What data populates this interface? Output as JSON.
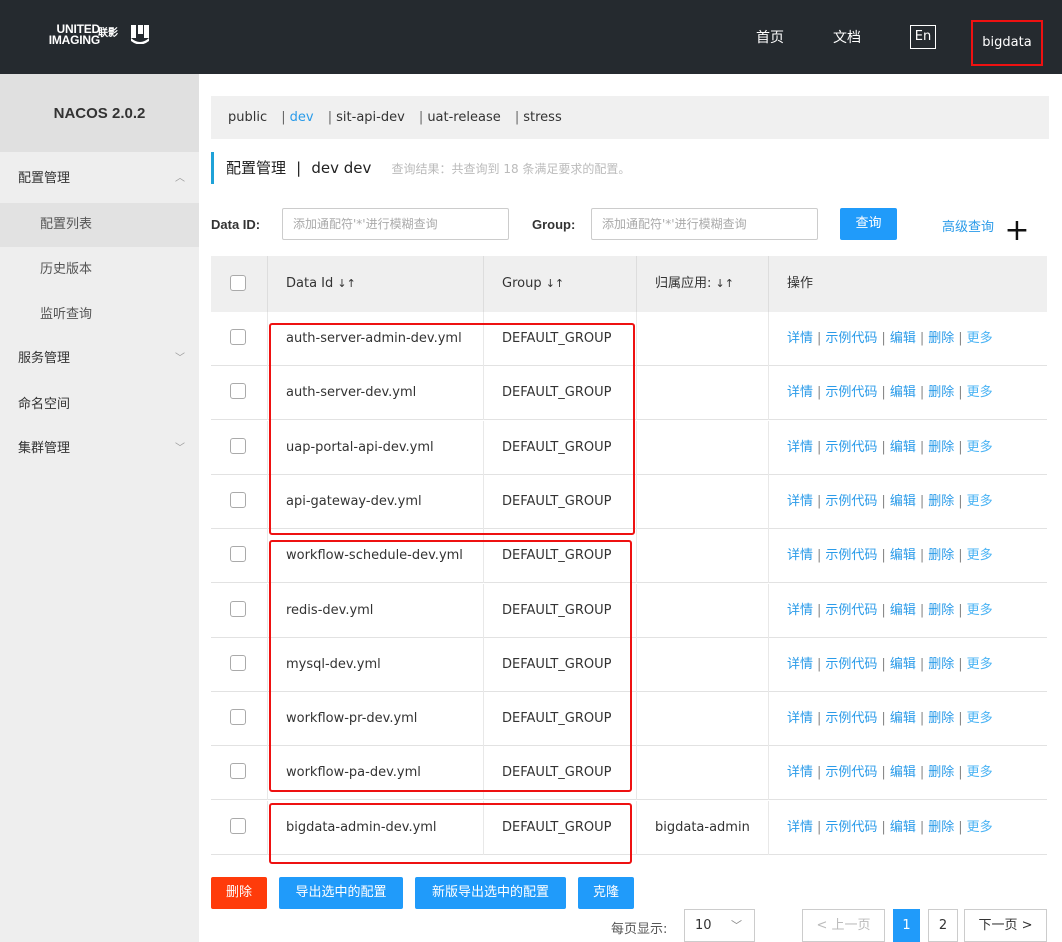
{
  "header": {
    "logo_line1": "UNITED",
    "logo_line2": "IMAGING",
    "logo_cn": "联影",
    "nav": [
      "首页",
      "文档"
    ],
    "lang": "En",
    "user": "bigdata"
  },
  "sidebar": {
    "title": "NACOS 2.0.2",
    "items": [
      {
        "label": "配置管理",
        "level": "top",
        "expanded": true
      },
      {
        "label": "配置列表",
        "level": "sub",
        "active": true
      },
      {
        "label": "历史版本",
        "level": "sub"
      },
      {
        "label": "监听查询",
        "level": "sub"
      },
      {
        "label": "服务管理",
        "level": "top"
      },
      {
        "label": "命名空间",
        "level": "top"
      },
      {
        "label": "集群管理",
        "level": "top"
      }
    ]
  },
  "namespaces": {
    "items": [
      "public",
      "dev",
      "sit-api-dev",
      "uat-release",
      "stress"
    ],
    "active": "dev",
    "separator": "|"
  },
  "heading": {
    "title": "配置管理",
    "separator": "|",
    "namespace": "dev  dev",
    "hint": "查询结果：共查询到 18 条满足要求的配置。"
  },
  "filters": {
    "data_id_label": "Data ID:",
    "data_id_placeholder": "添加通配符'*'进行模糊查询",
    "group_label": "Group:",
    "group_placeholder": "添加通配符'*'进行模糊查询",
    "query_button": "查询",
    "advanced_link": "高级查询",
    "plus": "+"
  },
  "table": {
    "headers": [
      "Data Id",
      "Group",
      "归属应用:",
      "操作"
    ],
    "sort_icon": "↓↑",
    "rows": [
      {
        "data_id": "auth-server-admin-dev.yml",
        "group": "DEFAULT_GROUP",
        "app": ""
      },
      {
        "data_id": "auth-server-dev.yml",
        "group": "DEFAULT_GROUP",
        "app": ""
      },
      {
        "data_id": "uap-portal-api-dev.yml",
        "group": "DEFAULT_GROUP",
        "app": ""
      },
      {
        "data_id": "api-gateway-dev.yml",
        "group": "DEFAULT_GROUP",
        "app": ""
      },
      {
        "data_id": "workflow-schedule-dev.yml",
        "group": "DEFAULT_GROUP",
        "app": ""
      },
      {
        "data_id": "redis-dev.yml",
        "group": "DEFAULT_GROUP",
        "app": ""
      },
      {
        "data_id": "mysql-dev.yml",
        "group": "DEFAULT_GROUP",
        "app": ""
      },
      {
        "data_id": "workflow-pr-dev.yml",
        "group": "DEFAULT_GROUP",
        "app": ""
      },
      {
        "data_id": "workflow-pa-dev.yml",
        "group": "DEFAULT_GROUP",
        "app": ""
      },
      {
        "data_id": "bigdata-admin-dev.yml",
        "group": "DEFAULT_GROUP",
        "app": "bigdata-admin"
      }
    ],
    "ops": {
      "detail": "详情",
      "sample": "示例代码",
      "edit": "编辑",
      "delete": "删除",
      "more": "更多",
      "sep": "|"
    }
  },
  "actions": {
    "delete": "删除",
    "export_selected": "导出选中的配置",
    "export_selected_new": "新版导出选中的配置",
    "clone": "克隆"
  },
  "pagination": {
    "per_page_label": "每页显示:",
    "per_page_value": "10",
    "prev": "< 上一页",
    "pages": [
      "1",
      "2"
    ],
    "current": "1",
    "next": "下一页 >"
  },
  "colors": {
    "header_bg": "#252a2f",
    "accent": "#209bfa",
    "link": "#2a9be9",
    "danger": "#ff3b0a",
    "highlight_box": "#ee1111"
  }
}
